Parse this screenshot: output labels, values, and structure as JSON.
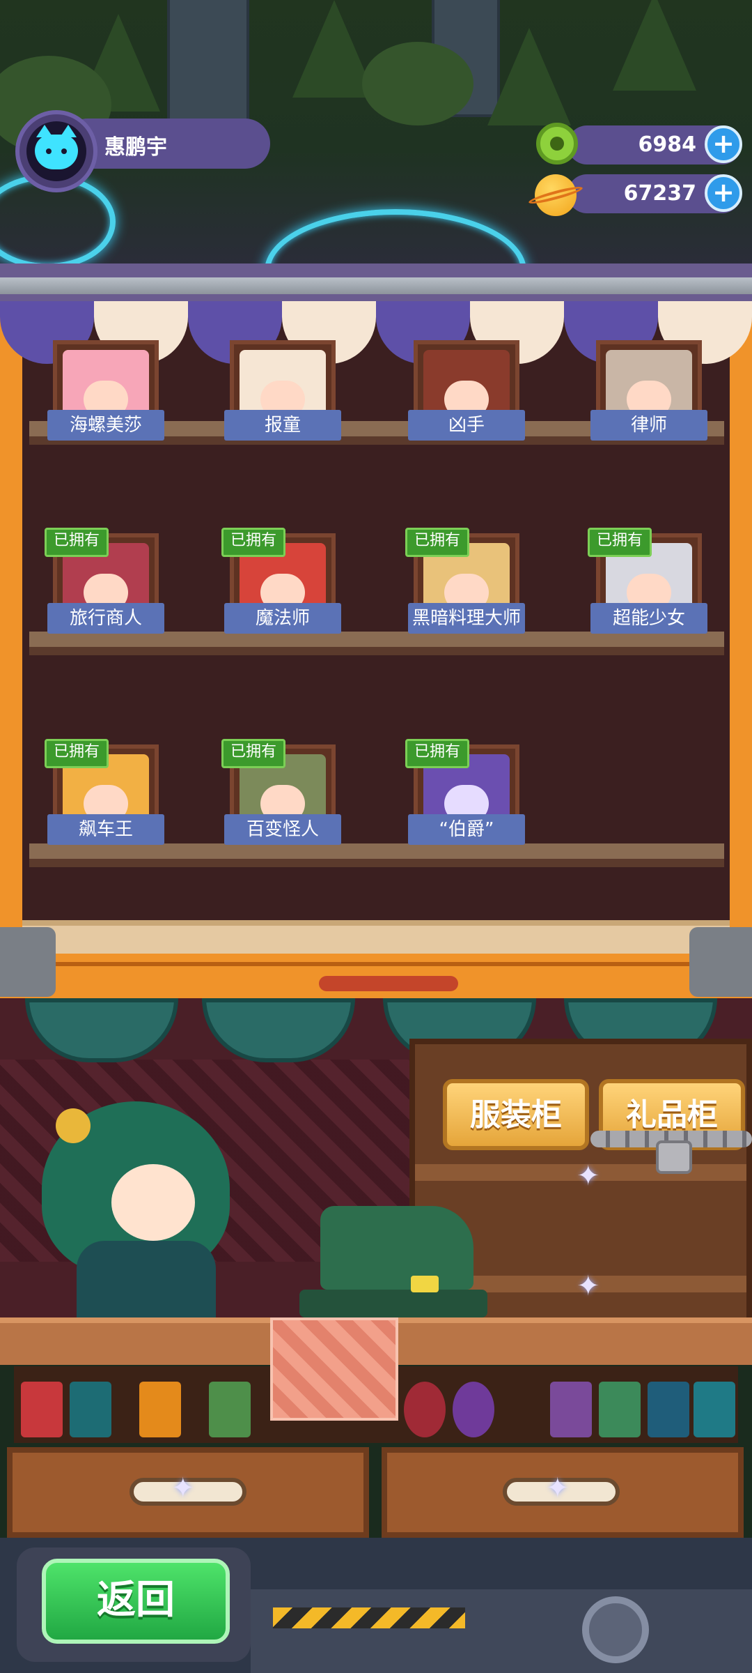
{
  "player": {
    "name": "惠鹏宇",
    "avatar_icon": "cat-avatar-icon"
  },
  "currencies": [
    {
      "icon": "donut-icon",
      "value": "6984"
    },
    {
      "icon": "planet-coin-icon",
      "value": "67237"
    }
  ],
  "shelf": {
    "owned_badge": "已拥有",
    "rows": [
      [
        {
          "label": "海螺美莎",
          "owned": false
        },
        {
          "label": "报童",
          "owned": false
        },
        {
          "label": "凶手",
          "owned": false
        },
        {
          "label": "律师",
          "owned": false
        }
      ],
      [
        {
          "label": "旅行商人",
          "owned": true
        },
        {
          "label": "魔法师",
          "owned": true
        },
        {
          "label": "黑暗料理大师",
          "owned": true
        },
        {
          "label": "超能少女",
          "owned": true
        }
      ],
      [
        {
          "label": "飙车王",
          "owned": true
        },
        {
          "label": "百变怪人",
          "owned": true
        },
        {
          "label": "“伯爵”",
          "owned": true
        }
      ]
    ]
  },
  "shop": {
    "wardrobe_label": "服装柜",
    "gift_cabinet_label": "礼品柜"
  },
  "bottom": {
    "back_label": "返回"
  },
  "colors": {
    "accent_purple": "#5b4f8f",
    "label_blue": "#5b72b6",
    "owned_green": "#3c9a2c",
    "cabinet_orange": "#f0932a",
    "back_green": "#21a843"
  }
}
